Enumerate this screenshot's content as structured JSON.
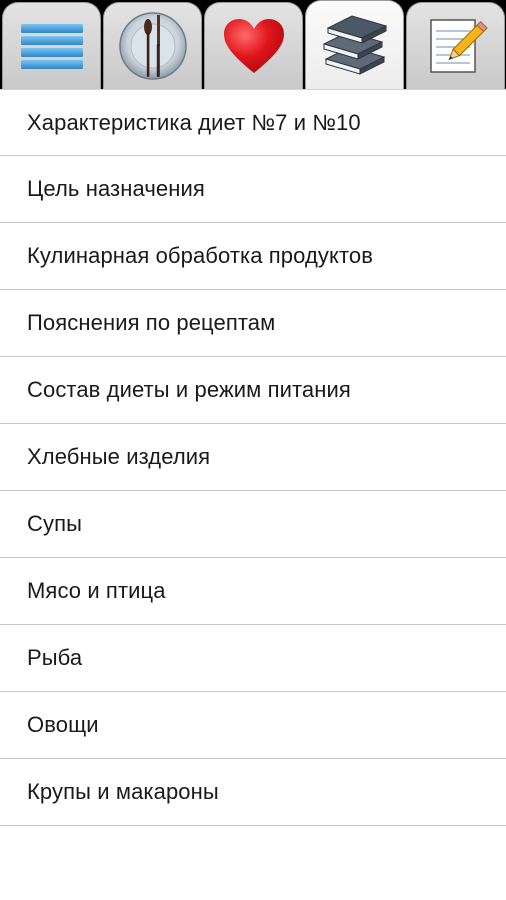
{
  "tabs": [
    {
      "icon": "menu-lines-icon",
      "active": false
    },
    {
      "icon": "plate-cutlery-icon",
      "active": false
    },
    {
      "icon": "heart-icon",
      "active": false
    },
    {
      "icon": "books-icon",
      "active": true
    },
    {
      "icon": "notepad-pencil-icon",
      "active": false
    }
  ],
  "colors": {
    "tabbar_bg": "#000000",
    "heart": "#e0151b",
    "menu_lines": "#3f9bd9",
    "book_cover": "#4d5866"
  },
  "items": [
    {
      "label": "Характеристика диет №7 и №10"
    },
    {
      "label": "Цель назначения"
    },
    {
      "label": "Кулинарная обработка продуктов"
    },
    {
      "label": "Пояснения по рецептам"
    },
    {
      "label": "Состав диеты и режим питания"
    },
    {
      "label": "Хлебные изделия"
    },
    {
      "label": "Супы"
    },
    {
      "label": "Мясо и птица"
    },
    {
      "label": "Рыба"
    },
    {
      "label": "Овощи"
    },
    {
      "label": "Крупы и макароны"
    }
  ]
}
